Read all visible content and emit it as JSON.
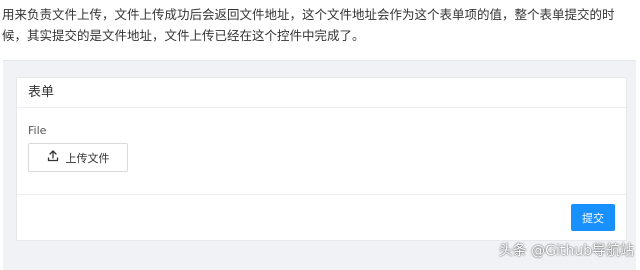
{
  "description": "用来负责文件上传，文件上传成功后会返回文件地址，这个文件地址会作为这个表单项的值，整个表单提交的时候，其实提交的是文件地址，文件上传已经在这个控件中完成了。",
  "form": {
    "title": "表单",
    "field": {
      "label": "File",
      "upload_button_label": "上传文件",
      "upload_icon": "upload-icon"
    },
    "submit_label": "提交"
  },
  "watermark": "头条 @Github导航站",
  "colors": {
    "primary": "#1890ff",
    "page_background": "#f0f2f5",
    "border": "#d9d9d9"
  }
}
